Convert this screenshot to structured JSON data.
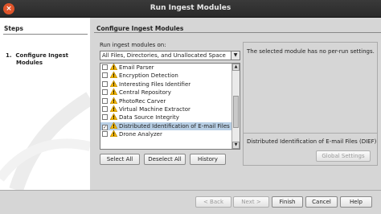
{
  "window": {
    "title": "Run Ingest Modules",
    "close_glyph": "×"
  },
  "steps": {
    "title": "Steps",
    "items": [
      {
        "number": "1.",
        "label_line1": "Configure Ingest",
        "label_line2": "Modules"
      }
    ]
  },
  "panel": {
    "title": "Configure Ingest Modules"
  },
  "run_on": {
    "label": "Run ingest modules on:",
    "selected": "All Files, Directories, and Unallocated Space"
  },
  "modules": [
    {
      "label": "Email Parser",
      "checked": false
    },
    {
      "label": "Encryption Detection",
      "checked": false
    },
    {
      "label": "Interesting Files Identifier",
      "checked": false
    },
    {
      "label": "Central Repository",
      "checked": false
    },
    {
      "label": "PhotoRec Carver",
      "checked": false
    },
    {
      "label": "Virtual Machine Extractor",
      "checked": false
    },
    {
      "label": "Data Source Integrity",
      "checked": false
    },
    {
      "label": "Distributed Identification of E-mail Files ...",
      "checked": true
    },
    {
      "label": "Drone Analyzer",
      "checked": false
    }
  ],
  "buttons": {
    "select_all": "Select All",
    "deselect_all": "Deselect All",
    "history": "History",
    "global_settings": "Global Settings"
  },
  "settings": {
    "message": "The selected module has no per-run settings.",
    "module_name": "Distributed Identification of E-mail Files (DIEF)"
  },
  "nav": {
    "back": "< Back",
    "next": "Next >",
    "finish": "Finish",
    "cancel": "Cancel",
    "help": "Help"
  },
  "colors": {
    "selection": "#b8cfe5",
    "close_button": "#e0552b",
    "warning_icon": "#f2b400"
  }
}
